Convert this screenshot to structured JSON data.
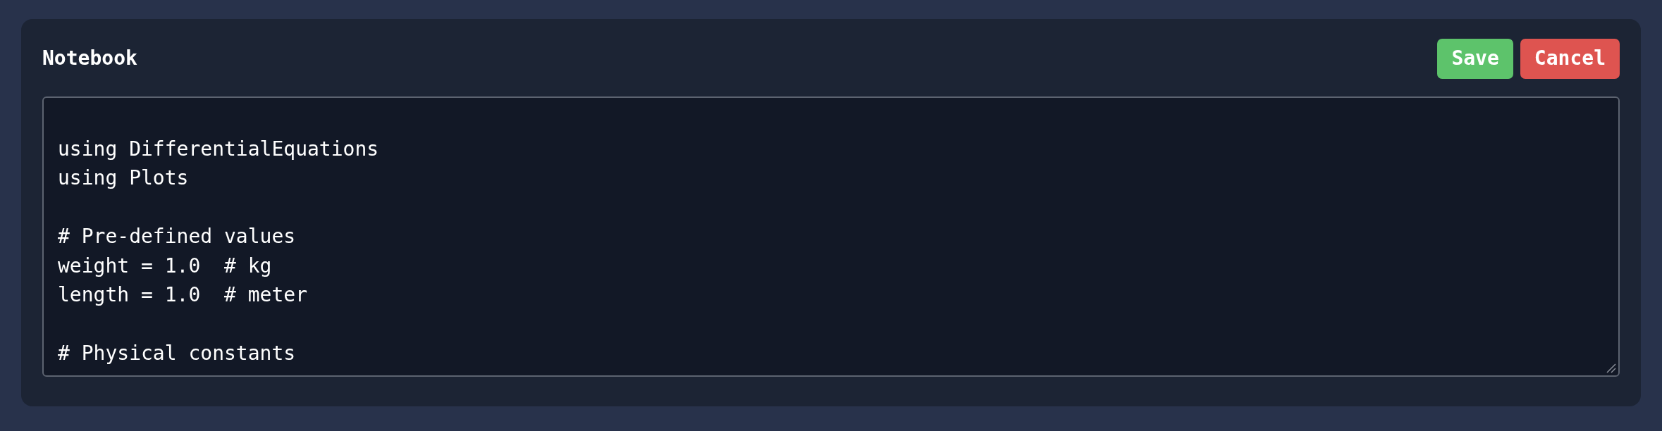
{
  "card": {
    "title": "Notebook"
  },
  "buttons": [
    {
      "kind": "save",
      "label": "Save"
    },
    {
      "kind": "cancel",
      "label": "Cancel"
    }
  ],
  "editor": {
    "value": "\nusing DifferentialEquations\nusing Plots\n\n# Pre-defined values\nweight = 1.0  # kg\nlength = 1.0  # meter\n\n# Physical constants"
  }
}
